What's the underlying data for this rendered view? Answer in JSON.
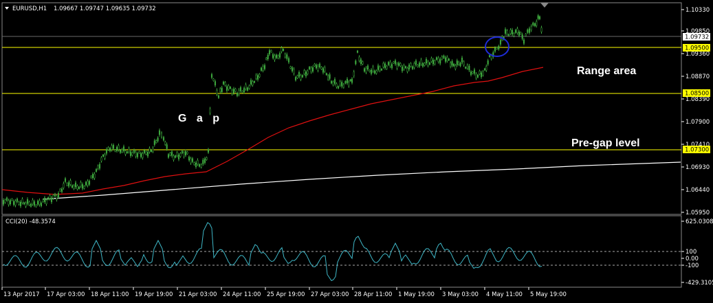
{
  "header": {
    "symbol": "EURUSD,H1",
    "ohlc": "1.09667 1.09747 1.09635 1.09732"
  },
  "price_axis": {
    "labels": [
      "1.10330",
      "1.09850",
      "1.09360",
      "1.08870",
      "1.08390",
      "1.07900",
      "1.07410",
      "1.06930",
      "1.06440",
      "1.05950"
    ],
    "current_price": "1.09732"
  },
  "levels": [
    {
      "label": "1.09500",
      "color": "#ffff00"
    },
    {
      "label": "1.08500",
      "color": "#ffff00"
    },
    {
      "label": "1.07300",
      "color": "#ffff00"
    }
  ],
  "annotations": {
    "gap": "G a p",
    "range_area": "Range area",
    "pre_gap_level": "Pre-gap level"
  },
  "cci": {
    "title": "CCI(20) -48.3574",
    "axis_labels": [
      "625.0308",
      "100",
      "0.00",
      "-100",
      "-429.3105"
    ]
  },
  "time_axis": {
    "labels": [
      "13 Apr 2017",
      "17 Apr 03:00",
      "18 Apr 11:00",
      "19 Apr 19:00",
      "21 Apr 03:00",
      "24 Apr 11:00",
      "25 Apr 19:00",
      "27 Apr 03:00",
      "28 Apr 11:00",
      "1 May 19:00",
      "3 May 03:00",
      "4 May 11:00",
      "5 May 19:00"
    ]
  },
  "colors": {
    "candles": "#3ea83e",
    "ma_red": "#e01010",
    "ma_white": "#ffffff",
    "cci_line": "#3fb8c8",
    "level_lines": "#ffff00",
    "circle": "#1e2cd8"
  },
  "chart_data": {
    "type": "line",
    "title": "EURUSD,H1",
    "price_range": [
      1.0595,
      1.1033
    ],
    "cci_range": [
      -429.3105,
      625.0308
    ],
    "horizontal_levels": [
      1.095,
      1.085,
      1.073
    ],
    "price_series_approx": [
      {
        "x": "13 Apr 2017",
        "y": 1.0615
      },
      {
        "x": "17 Apr 03:00",
        "y": 1.0625
      },
      {
        "x": "18 Apr 11:00",
        "y": 1.0735
      },
      {
        "x": "19 Apr 19:00",
        "y": 1.0775
      },
      {
        "x": "21 Apr 03:00",
        "y": 1.0715
      },
      {
        "x": "24 Apr 11:00",
        "y": 1.085
      },
      {
        "x": "25 Apr 19:00",
        "y": 1.0935
      },
      {
        "x": "27 Apr 03:00",
        "y": 1.087
      },
      {
        "x": "28 Apr 11:00",
        "y": 1.0895
      },
      {
        "x": "1 May 19:00",
        "y": 1.0905
      },
      {
        "x": "3 May 03:00",
        "y": 1.0915
      },
      {
        "x": "4 May 11:00",
        "y": 1.098
      },
      {
        "x": "5 May 19:00",
        "y": 1.0973
      }
    ]
  }
}
